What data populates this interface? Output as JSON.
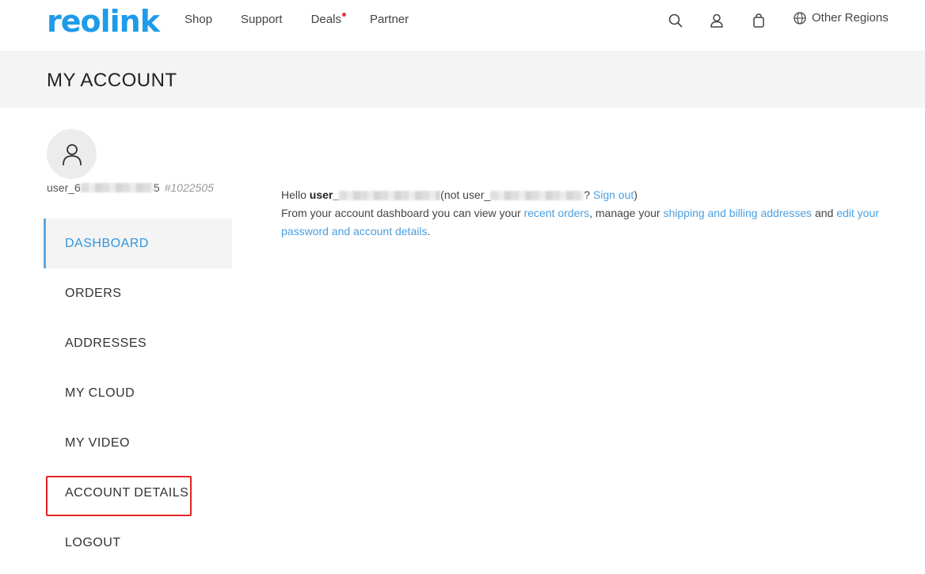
{
  "header": {
    "logo": "reolink",
    "nav": [
      {
        "label": "Shop",
        "badge": false
      },
      {
        "label": "Support",
        "badge": false
      },
      {
        "label": "Deals",
        "badge": true
      },
      {
        "label": "Partner",
        "badge": false
      }
    ],
    "icons": [
      "search-icon",
      "user-icon",
      "cart-icon",
      "globe-icon"
    ],
    "region_label": "Other Regions"
  },
  "page_title": "MY ACCOUNT",
  "sidebar": {
    "username_prefix": "user_6",
    "username_tail": "5",
    "user_id": "#1022505",
    "menu": [
      {
        "label": "DASHBOARD",
        "active": true
      },
      {
        "label": "ORDERS",
        "active": false
      },
      {
        "label": "ADDRESSES",
        "active": false
      },
      {
        "label": "MY CLOUD",
        "active": false
      },
      {
        "label": "MY VIDEO",
        "active": false
      },
      {
        "label": "ACCOUNT DETAILS",
        "active": false,
        "highlighted": true
      },
      {
        "label": "LOGOUT",
        "active": false
      }
    ]
  },
  "main": {
    "hello": "Hello ",
    "user_bold": "user_",
    "not_user": "(not user_",
    "question": "? ",
    "sign_out": "Sign out",
    "close_paren": ")",
    "line2_a": "From your account dashboard you can view your ",
    "recent_orders": "recent orders",
    "line2_b": ", manage your ",
    "addresses": "shipping and billing addresses",
    "line2_c": " and ",
    "edit_details": "edit your password and account details",
    "period": "."
  },
  "colors": {
    "brand": "#1e9be9",
    "link": "#4a9fe0",
    "active": "#2f97dc",
    "highlight_border": "#e02424",
    "band": "#f4f4f4"
  }
}
